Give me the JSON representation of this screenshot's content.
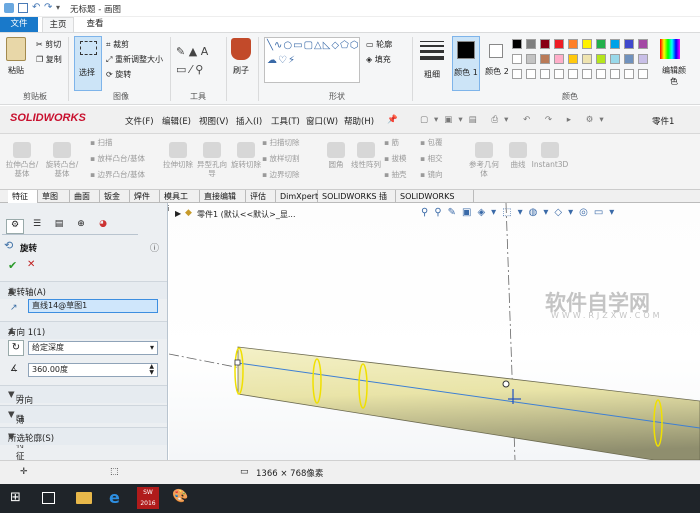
{
  "paint": {
    "title": "无标题 - 画图",
    "tabs": [
      "文件",
      "主页",
      "查看"
    ],
    "clipboard": {
      "paste": "粘贴",
      "cut": "剪切",
      "copy": "复制",
      "group": "剪贴板"
    },
    "image": {
      "select": "选择",
      "crop": "裁剪",
      "resize": "重新调整大小",
      "rotate": "旋转",
      "group": "图像"
    },
    "tools": {
      "group": "工具"
    },
    "brush": {
      "label": "刷子"
    },
    "shapes": {
      "outline": "轮廓",
      "fill": "填充",
      "group": "形状"
    },
    "size": {
      "label": "粗细"
    },
    "colors": {
      "color1": "颜色 1",
      "color2": "颜色 2",
      "edit": "编辑颜色",
      "group": "颜色",
      "palette": [
        "#000000",
        "#7f7f7f",
        "#880015",
        "#ed1c24",
        "#ff7f27",
        "#fff200",
        "#22b14c",
        "#00a2e8",
        "#3f48cc",
        "#a349a4",
        "#ffffff",
        "#c3c3c3",
        "#b97a57",
        "#ffaec9",
        "#ffc90e",
        "#efe4b0",
        "#b5e61d",
        "#99d9ea",
        "#7092be",
        "#c8bfe7"
      ]
    }
  },
  "sw": {
    "logo": "SOLIDWORKS",
    "menu": [
      "文件(F)",
      "编辑(E)",
      "视图(V)",
      "插入(I)",
      "工具(T)",
      "窗口(W)",
      "帮助(H)"
    ],
    "part": "零件1",
    "commands": [
      "拉伸凸台/基体",
      "旋转凸台/基体",
      "扫描",
      "放样凸台/基体",
      "边界凸台/基体",
      "拉伸切除",
      "异型孔向导",
      "旋转切除",
      "扫描切除",
      "放样切割",
      "边界切除",
      "圆角",
      "线性阵列",
      "筋",
      "拔模",
      "抽壳",
      "包覆",
      "相交",
      "镜向",
      "参考几何体",
      "曲线",
      "Instant3D"
    ],
    "cmtabs": [
      "特征",
      "草图",
      "曲面",
      "钣金",
      "焊件",
      "模具工具",
      "直接编辑",
      "评估",
      "DimXpert",
      "SOLIDWORKS 插件",
      "SOLIDWORKS MBD"
    ],
    "tree": "零件1 (默认<<默认>_显...",
    "pm": {
      "title": "旋转",
      "axis_label": "旋转轴(A)",
      "axis_value": "直线14@草图1",
      "dir1": "方向 1(1)",
      "dir1_type": "给定深度",
      "angle": "360.00度",
      "dir2": "方向 2(2)",
      "thin": "薄壁特征(T)",
      "contour": "所选轮廓(S)"
    },
    "watermark": "软件自学网",
    "watermark_url": "WWW.RJZXW.COM"
  },
  "status": {
    "dims": "1366 × 768像素"
  },
  "taskbar": {
    "badge": "SW 2016"
  }
}
